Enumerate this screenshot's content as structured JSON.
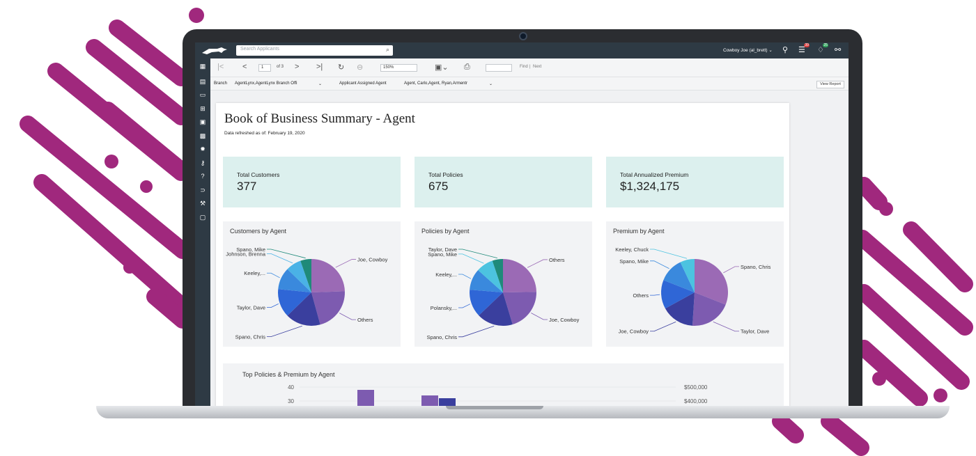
{
  "colors": {
    "brand": "#a0287d",
    "appbar": "#2e3a44",
    "kpi_bg": "#dcf0ee"
  },
  "header": {
    "search_placeholder": "Search Applicants",
    "user": "Cowboy Joe (al_brett) ⌄",
    "badges": {
      "tasks": "39",
      "notifications": "25"
    }
  },
  "toolbar": {
    "page": "1",
    "of_pages": "of 3",
    "zoom": "150%",
    "find": "Find",
    "separator": "|",
    "next": "Next"
  },
  "params": {
    "branch_label": "Branch",
    "branch_value": "AgentLynx,AgentLynx Branch Offi",
    "agent_label": "Applicant Assigned Agent",
    "agent_value": "Agent, Carlo,Agent, Ryan,Armentr",
    "view_report": "View Report"
  },
  "report": {
    "title": "Book of Business Summary - Agent",
    "refreshed": "Data refreshed as of: February 19, 2020",
    "kpis": [
      {
        "label": "Total Customers",
        "value": "377"
      },
      {
        "label": "Total Policies",
        "value": "675"
      },
      {
        "label": "Total Annualized Premium",
        "value": "$1,324,175"
      }
    ],
    "bar_title": "Top Policies & Premium by Agent"
  },
  "chart_data": [
    {
      "type": "pie",
      "title": "Customers by Agent",
      "labels": [
        "Joe, Cowboy",
        "Others",
        "Spano, Chris",
        "Taylor, Dave",
        "Keeley,...",
        "Johnson, Brenna",
        "Spano, Mike"
      ],
      "values": [
        23,
        20,
        16,
        13,
        10,
        7,
        5
      ],
      "colors": [
        "#9b6ab5",
        "#7d5bb0",
        "#3a3f9e",
        "#2f66d6",
        "#3a89dd",
        "#4ab2e6",
        "#1f8a7a"
      ]
    },
    {
      "type": "pie",
      "title": "Policies by Agent",
      "labels": [
        "Others",
        "Joe, Cowboy",
        "Spano, Chris",
        "Polansky,...",
        "Keeley,...",
        "Spano, Mike",
        "Taylor, Dave"
      ],
      "values": [
        24,
        20,
        17,
        13,
        10,
        8,
        5
      ],
      "colors": [
        "#9b6ab5",
        "#7d5bb0",
        "#3a3f9e",
        "#2f66d6",
        "#3a89dd",
        "#4cc3e0",
        "#1f8a7a"
      ]
    },
    {
      "type": "pie",
      "title": "Premium by Agent",
      "labels": [
        "Spano, Chris",
        "Taylor, Dave",
        "Joe, Cowboy",
        "Others",
        "Spano, Mike",
        "Keeley, Chuck"
      ],
      "values": [
        31,
        20,
        16,
        14,
        12,
        7
      ],
      "colors": [
        "#9b6ab5",
        "#7d5bb0",
        "#3a3f9e",
        "#2f66d6",
        "#3a89dd",
        "#4cc3e0"
      ]
    },
    {
      "type": "bar",
      "title": "Top Policies & Premium by Agent",
      "left_axis_ticks": [
        "40",
        "30"
      ],
      "right_axis_ticks": [
        "$500,000",
        "$400,000"
      ],
      "series": [
        {
          "values": [
            38,
            null,
            34,
            null
          ]
        },
        {
          "values": [
            null,
            null,
            null,
            32
          ]
        }
      ]
    }
  ]
}
